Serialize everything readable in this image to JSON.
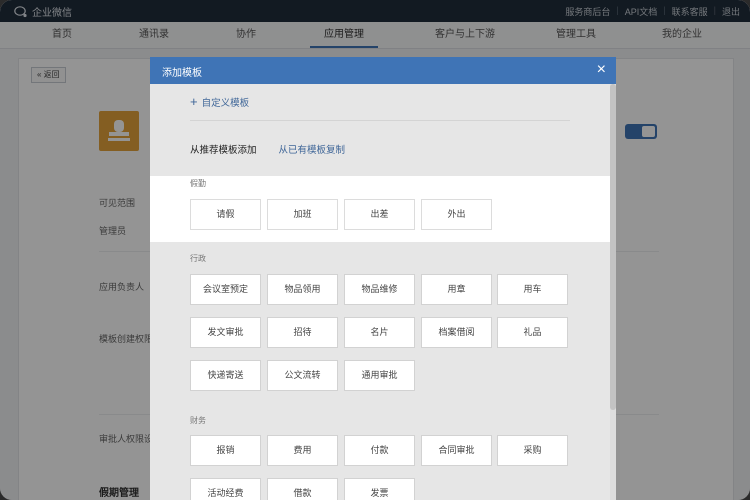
{
  "topbar": {
    "logo_text": "企业微信",
    "links": [
      "服务商后台",
      "API文档",
      "联系客服",
      "退出"
    ]
  },
  "nav": {
    "items": [
      "首页",
      "通讯录",
      "协作",
      "应用管理",
      "客户与上下游",
      "管理工具",
      "我的企业"
    ],
    "active_index": 3
  },
  "background": {
    "back_label": "« 返回",
    "labels": [
      "可见范围",
      "管理员",
      "应用负责人",
      "模板创建权限",
      "审批人权限设",
      "假期管理"
    ],
    "toggle_on": true
  },
  "modal": {
    "title": "添加模板",
    "close_icon": "×",
    "custom_template": "自定义模板",
    "tab_recommend": "从推荐模板添加",
    "tab_copy": "从已有模板复制",
    "sections": [
      {
        "label": "假勤",
        "items": [
          "请假",
          "加班",
          "出差",
          "外出"
        ]
      },
      {
        "label": "行政",
        "items": [
          "会议室预定",
          "物品领用",
          "物品维修",
          "用章",
          "用车",
          "发文审批",
          "招待",
          "名片",
          "档案借阅",
          "礼品",
          "快递寄送",
          "公文流转",
          "通用审批"
        ]
      },
      {
        "label": "财务",
        "items": [
          "报销",
          "费用",
          "付款",
          "合同审批",
          "采购",
          "活动经费",
          "借款",
          "发票"
        ]
      }
    ]
  },
  "colors": {
    "topbar": "#202d3b",
    "accent": "#3f74b6",
    "link": "#3f6698",
    "app_icon": "#e3a23b"
  }
}
